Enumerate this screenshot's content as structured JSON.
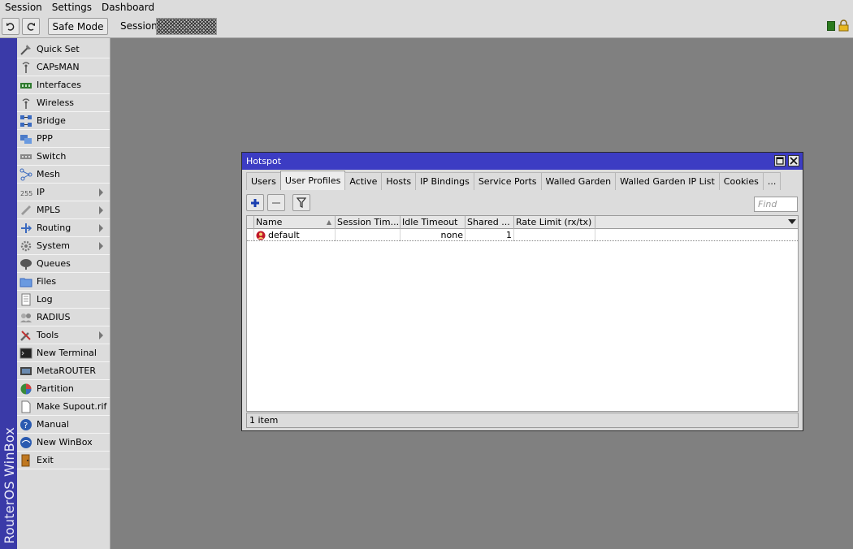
{
  "menu": [
    "Session",
    "Settings",
    "Dashboard"
  ],
  "toolbar": {
    "undo_icon": "undo-icon",
    "redo_icon": "redo-icon",
    "safe_mode_label": "Safe Mode",
    "session_label": "Session:"
  },
  "brand": {
    "text": "RouterOS WinBox",
    "color": "#3a3aa8"
  },
  "nav": [
    {
      "label": "Quick Set",
      "icon": "quick-set-icon"
    },
    {
      "label": "CAPsMAN",
      "icon": "capsman-icon"
    },
    {
      "label": "Interfaces",
      "icon": "interfaces-icon"
    },
    {
      "label": "Wireless",
      "icon": "wireless-icon"
    },
    {
      "label": "Bridge",
      "icon": "bridge-icon"
    },
    {
      "label": "PPP",
      "icon": "ppp-icon"
    },
    {
      "label": "Switch",
      "icon": "switch-icon"
    },
    {
      "label": "Mesh",
      "icon": "mesh-icon"
    },
    {
      "label": "IP",
      "icon": "ip-icon",
      "submenu": true
    },
    {
      "label": "MPLS",
      "icon": "mpls-icon",
      "submenu": true
    },
    {
      "label": "Routing",
      "icon": "routing-icon",
      "submenu": true
    },
    {
      "label": "System",
      "icon": "system-icon",
      "submenu": true
    },
    {
      "label": "Queues",
      "icon": "queues-icon"
    },
    {
      "label": "Files",
      "icon": "files-icon"
    },
    {
      "label": "Log",
      "icon": "log-icon"
    },
    {
      "label": "RADIUS",
      "icon": "radius-icon"
    },
    {
      "label": "Tools",
      "icon": "tools-icon",
      "submenu": true
    },
    {
      "label": "New Terminal",
      "icon": "terminal-icon"
    },
    {
      "label": "MetaROUTER",
      "icon": "metarouter-icon"
    },
    {
      "label": "Partition",
      "icon": "partition-icon"
    },
    {
      "label": "Make Supout.rif",
      "icon": "supout-icon"
    },
    {
      "label": "Manual",
      "icon": "manual-icon"
    },
    {
      "label": "New WinBox",
      "icon": "new-winbox-icon"
    },
    {
      "label": "Exit",
      "icon": "exit-icon"
    }
  ],
  "window": {
    "title": "Hotspot",
    "tabs": [
      "Users",
      "User Profiles",
      "Active",
      "Hosts",
      "IP Bindings",
      "Service Ports",
      "Walled Garden",
      "Walled Garden IP List",
      "Cookies",
      "..."
    ],
    "active_tab": "User Profiles",
    "find_placeholder": "Find",
    "columns": [
      "Name",
      "Session Tim...",
      "Idle Timeout",
      "Shared ...",
      "Rate Limit (rx/tx)"
    ],
    "rows": [
      {
        "name": "default",
        "session_timeout": "",
        "idle_timeout": "none",
        "shared_users": "1",
        "rate_limit": ""
      }
    ],
    "status": "1 item"
  },
  "colors": {
    "title_bar": "#3c3cc3",
    "desktop": "#808080",
    "panel": "#dcdcdc"
  }
}
